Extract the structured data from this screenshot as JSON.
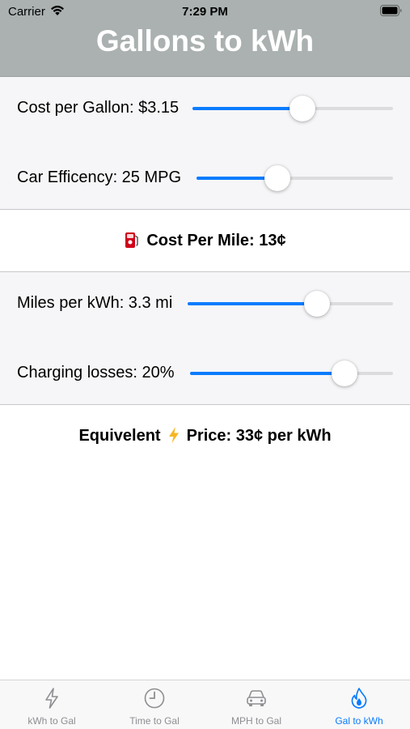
{
  "status_bar": {
    "carrier": "Carrier",
    "time": "7:29 PM"
  },
  "nav": {
    "title": "Gallons to kWh"
  },
  "gas_section": {
    "cost_per_gallon": {
      "label": "Cost per Gallon: $3.15",
      "value": 0.55
    },
    "car_efficiency": {
      "label": "Car Efficency: 25 MPG",
      "value": 0.41
    }
  },
  "cost_per_mile": {
    "icon": "fuel-pump-icon",
    "label": "Cost Per Mile: 13¢"
  },
  "electric_section": {
    "miles_per_kwh": {
      "label": "Miles per kWh: 3.3 mi",
      "value": 0.63
    },
    "charging_losses": {
      "label": "Charging losses: 20%",
      "value": 0.76
    }
  },
  "equivalent": {
    "prefix": "Equivelent",
    "icon": "lightning-icon",
    "suffix": "Price: 33¢ per kWh"
  },
  "tabs": [
    {
      "label": "kWh to Gal",
      "icon": "bolt-icon",
      "active": false
    },
    {
      "label": "Time to Gal",
      "icon": "clock-icon",
      "active": false
    },
    {
      "label": "MPH to Gal",
      "icon": "car-icon",
      "active": false
    },
    {
      "label": "Gal to kWh",
      "icon": "flame-icon",
      "active": true
    }
  ],
  "colors": {
    "accent": "#0a7cff",
    "header_bg": "#aab1b0",
    "inactive_tab": "#8e8e93"
  }
}
